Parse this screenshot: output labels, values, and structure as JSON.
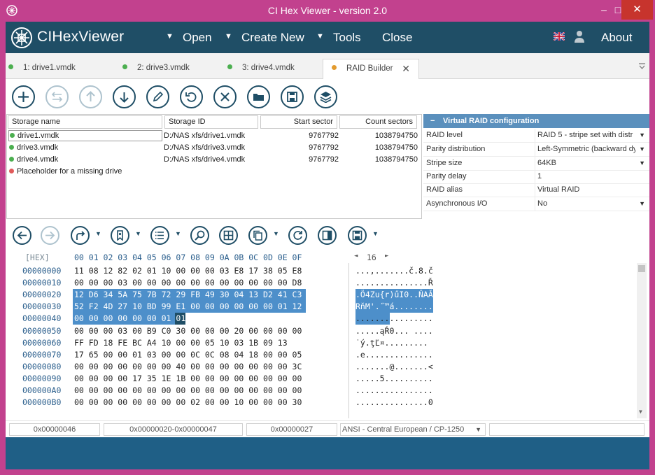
{
  "window": {
    "title": "CI Hex Viewer - version 2.0",
    "min": "–",
    "max": "□",
    "close": "✕"
  },
  "menu": {
    "brand": "CIHexViewer",
    "items": [
      {
        "label": "Open",
        "has_arrow": true
      },
      {
        "label": "Create New",
        "has_arrow": true
      },
      {
        "label": "Tools",
        "has_arrow": true
      },
      {
        "label": "Close",
        "has_arrow": false
      }
    ],
    "about": "About",
    "arrow_glyph": "▼"
  },
  "tabs": [
    {
      "label": "1: drive1.vmdk",
      "dot_color": "#4caf50"
    },
    {
      "label": "2: drive3.vmdk",
      "dot_color": "#4caf50"
    },
    {
      "label": "3: drive4.vmdk",
      "dot_color": "#4caf50"
    },
    {
      "label": "RAID Builder",
      "dot_color": "#e39b2f",
      "active": true,
      "close": "✕"
    }
  ],
  "toolbar1": [
    {
      "icon": "add-icon",
      "disabled": false
    },
    {
      "icon": "merge-icon",
      "disabled": true
    },
    {
      "icon": "move-up-icon",
      "disabled": true
    },
    {
      "icon": "move-down-icon",
      "disabled": false
    },
    {
      "icon": "edit-icon",
      "disabled": false
    },
    {
      "icon": "undo-icon",
      "disabled": false
    },
    {
      "icon": "remove-icon",
      "disabled": false
    },
    {
      "icon": "folder-icon",
      "disabled": false
    },
    {
      "icon": "save-icon",
      "disabled": false
    },
    {
      "icon": "layers-icon",
      "disabled": false
    }
  ],
  "storage": {
    "columns": [
      "Storage name",
      "Storage ID",
      "Start sector",
      "Count sectors"
    ],
    "rows": [
      {
        "name": "drive1.vmdk",
        "id": "D:/NAS xfs/drive1.vmdk",
        "start": "9767792",
        "count": "1038794750",
        "status": "#4caf50"
      },
      {
        "name": "drive3.vmdk",
        "id": "D:/NAS xfs/drive3.vmdk",
        "start": "9767792",
        "count": "1038794750",
        "status": "#4caf50"
      },
      {
        "name": "drive4.vmdk",
        "id": "D:/NAS xfs/drive4.vmdk",
        "start": "9767792",
        "count": "1038794750",
        "status": "#4caf50"
      },
      {
        "name": "Placeholder for a missing drive",
        "id": "",
        "start": "",
        "count": "",
        "status": "#e05a5a"
      }
    ]
  },
  "raid": {
    "title": "Virtual RAID configuration",
    "collapse": "−",
    "props": [
      {
        "name": "RAID level",
        "value": "RAID 5 - stripe set with distr",
        "dropdown": true
      },
      {
        "name": "Parity distribution",
        "value": "Left-Symmetric (backward dy",
        "dropdown": true
      },
      {
        "name": "Stripe size",
        "value": "64KB",
        "dropdown": true
      },
      {
        "name": "Parity delay",
        "value": "1",
        "dropdown": false
      },
      {
        "name": "RAID alias",
        "value": "Virtual RAID",
        "dropdown": false
      },
      {
        "name": "Asynchronous I/O",
        "value": "No",
        "dropdown": true
      }
    ]
  },
  "toolbar2": [
    {
      "icon": "back-icon",
      "disabled": false,
      "dropdown": false
    },
    {
      "icon": "forward-icon",
      "disabled": true,
      "dropdown": false
    },
    {
      "icon": "goto-icon",
      "disabled": false,
      "dropdown": true
    },
    {
      "icon": "bookmark-icon",
      "disabled": false,
      "dropdown": true
    },
    {
      "icon": "list-icon",
      "disabled": false,
      "dropdown": true
    },
    {
      "icon": "find-icon",
      "disabled": false,
      "dropdown": false
    },
    {
      "icon": "grid-icon",
      "disabled": false,
      "dropdown": false
    },
    {
      "icon": "copy-icon",
      "disabled": false,
      "dropdown": true
    },
    {
      "icon": "refresh-icon",
      "disabled": false,
      "dropdown": false
    },
    {
      "icon": "panel-icon",
      "disabled": false,
      "dropdown": false
    },
    {
      "icon": "save-icon",
      "disabled": false,
      "dropdown": true
    }
  ],
  "hex": {
    "header_label": "[HEX]",
    "columns": "00 01 02 03 04 05 06 07 08 09 0A 0B 0C 0D 0E 0F",
    "cols_left": "◄",
    "cols_value": "16",
    "cols_right": "►",
    "rows": [
      {
        "offset": "00000000",
        "hex": "11 08 12 82 02 01 10 00 00 00 03 E8 17 38 05 E8",
        "ascii": "...,.......č.8.č"
      },
      {
        "offset": "00000010",
        "hex": "00 00 00 03 00 00 00 00 00 00 00 00 00 00 00 D8",
        "ascii": "...............Ř"
      },
      {
        "offset": "00000020",
        "hex": "12 D6 34 5A 75 7B 72 29 FB 49 30 04 13 D2 41 C3",
        "ascii": ".Ö4Zu{r)űI0..ŇAĂ"
      },
      {
        "offset": "00000030",
        "hex": "52 F2 4D 27 10 BD 99 E1 00 00 00 00 00 00 01 12",
        "ascii": "RňM'.˝™á........"
      },
      {
        "offset": "00000040",
        "hex": "00 00 00 00 00 00 01 01 00 00 00 00 00 00 01 02",
        "ascii": "................"
      },
      {
        "offset": "00000050",
        "hex": "00 00 00 03 00 B9 C0 30 00 00 00 20 00 00 00 00",
        "ascii": ".....ąŔ0... ...."
      },
      {
        "offset": "00000060",
        "hex": "FF FD 18 FE BC A4 10 00 00 05 10 03 1B 09 13",
        "ascii": "˙ý.ţĽ¤........."
      },
      {
        "offset": "00000070",
        "hex": "17 65 00 00 01 03 00 00 0C 0C 08 04 18 00 00 05",
        "ascii": ".e.............."
      },
      {
        "offset": "00000080",
        "hex": "00 00 00 00 00 00 00 40 00 00 00 00 00 00 00 3C",
        "ascii": ".......@.......<"
      },
      {
        "offset": "00000090",
        "hex": "00 00 00 00 17 35 1E 1B 00 00 00 00 00 00 00 00",
        "ascii": ".....5.........."
      },
      {
        "offset": "000000A0",
        "hex": "00 00 00 00 00 00 00 00 00 00 00 00 00 00 00 00",
        "ascii": "................"
      },
      {
        "offset": "000000B0",
        "hex": "00 00 00 00 00 00 00 00 02 00 00 10 00 00 00 30",
        "ascii": "...............0"
      }
    ]
  },
  "status": {
    "cursor": "0x00000046",
    "selection": "0x00000020-0x00000047",
    "length": "0x00000027",
    "encoding": "ANSI - Central European / CP-1250",
    "encoding_arrow": "▼"
  },
  "colors": {
    "brand_bar": "#1f4e66",
    "window_frame": "#c2418e",
    "selection": "#4d8fca",
    "raid_header": "#5b90bd"
  }
}
